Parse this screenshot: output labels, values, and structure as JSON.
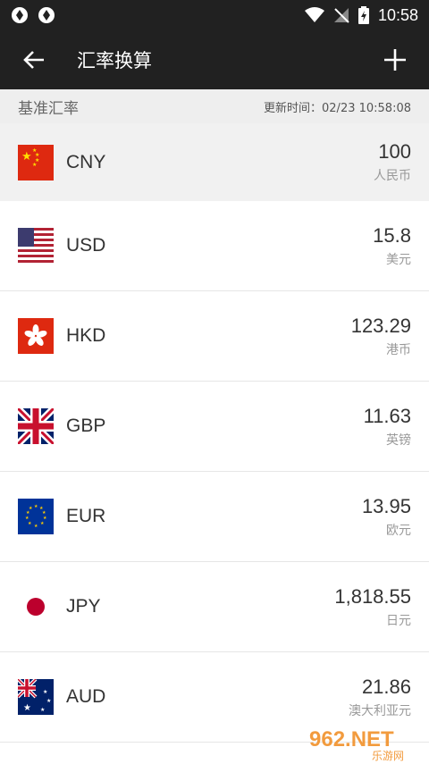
{
  "status": {
    "time": "10:58"
  },
  "header": {
    "title": "汇率换算"
  },
  "subheader": {
    "label": "基准汇率",
    "updated": "更新时间：02/23 10:58:08"
  },
  "currencies": [
    {
      "code": "CNY",
      "amount": "100",
      "name": "人民币",
      "flag": "china-flag-icon"
    },
    {
      "code": "USD",
      "amount": "15.8",
      "name": "美元",
      "flag": "usa-flag-icon"
    },
    {
      "code": "HKD",
      "amount": "123.29",
      "name": "港币",
      "flag": "hongkong-flag-icon"
    },
    {
      "code": "GBP",
      "amount": "11.63",
      "name": "英镑",
      "flag": "uk-flag-icon"
    },
    {
      "code": "EUR",
      "amount": "13.95",
      "name": "欧元",
      "flag": "eu-flag-icon"
    },
    {
      "code": "JPY",
      "amount": "1,818.55",
      "name": "日元",
      "flag": "japan-flag-icon"
    },
    {
      "code": "AUD",
      "amount": "21.86",
      "name": "澳大利亚元",
      "flag": "australia-flag-icon"
    }
  ],
  "watermark": {
    "text": "962.NET",
    "sub": "乐游网"
  }
}
